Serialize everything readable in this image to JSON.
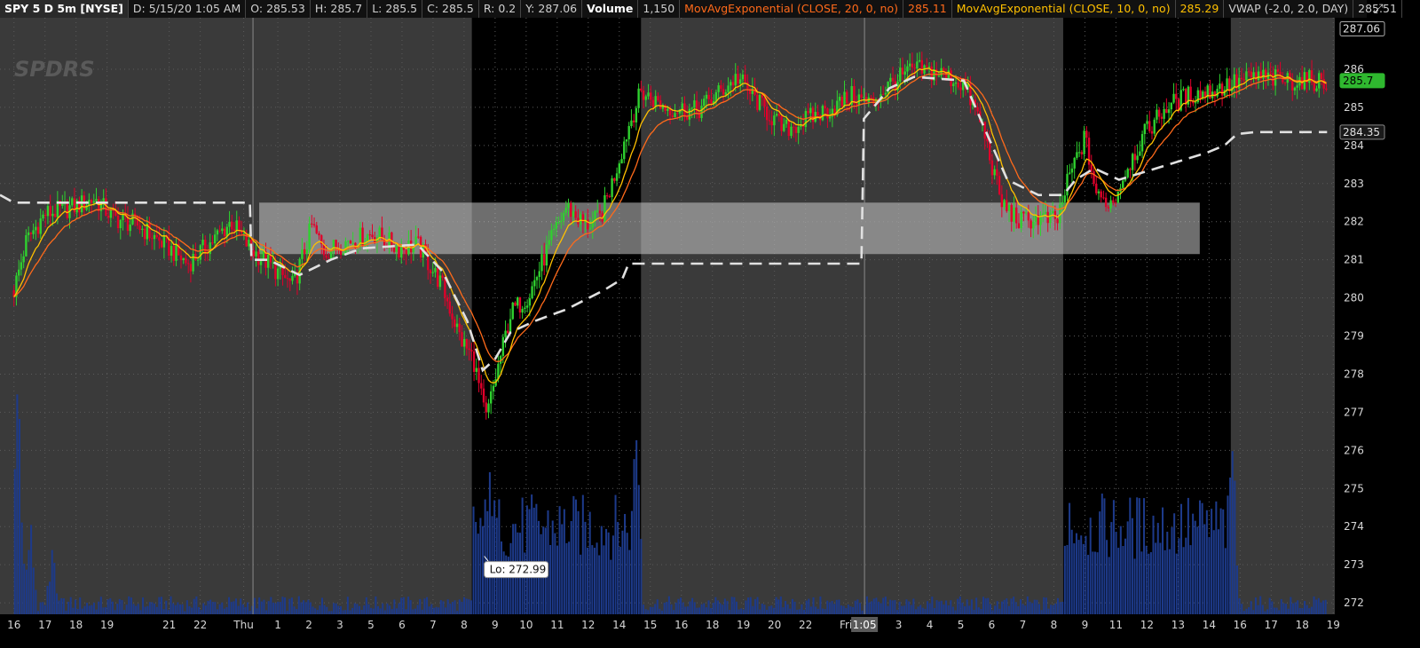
{
  "header": {
    "symbol": "SPY 5 D 5m [NYSE]",
    "date": "D: 5/15/20 1:05 AM",
    "open": "O: 285.53",
    "high": "H: 285.7",
    "low": "L: 285.5",
    "close": "C: 285.5",
    "range": "R: 0.2",
    "y": "Y: 287.06",
    "volume_label": "Volume",
    "volume_value": "1,150",
    "ema20_label": "MovAvgExponential (CLOSE, 20, 0, no)",
    "ema20_value": "285.11",
    "ema10_label": "MovAvgExponential (CLOSE, 10, 0, no)",
    "ema10_value": "285.29",
    "vwap_label": "VWAP (-2.0, 2.0, DAY)",
    "vwap_value": "285.51",
    "corner_icon": "expand-icon"
  },
  "watermark": "SPDRS",
  "colors": {
    "background": "#000000",
    "extended_hours_bg": "#3a3a3a",
    "up_candle": "#2fd12f",
    "down_candle": "#e0002a",
    "ema20": "#ff6a1a",
    "ema10": "#ffc000",
    "vwap": "#e0e0e0",
    "volume": "#1d3a8a",
    "price_tag_current": "#2fb82f",
    "zone": "#c8c8c8"
  },
  "chart_data": {
    "type": "candlestick",
    "symbol": "SPY",
    "interval": "5m",
    "ylim": [
      271.7,
      287.35
    ],
    "y_ticks": [
      272,
      273,
      274,
      275,
      276,
      277,
      278,
      279,
      280,
      281,
      282,
      283,
      284,
      285,
      286
    ],
    "x_ticks": [
      {
        "label": "16",
        "x": 0
      },
      {
        "label": "17",
        "x": 1
      },
      {
        "label": "18",
        "x": 2
      },
      {
        "label": "19",
        "x": 3
      },
      {
        "label": "21",
        "x": 5
      },
      {
        "label": "22",
        "x": 6
      },
      {
        "label": "Thu",
        "x": 7.4
      },
      {
        "label": "1",
        "x": 8.5
      },
      {
        "label": "2",
        "x": 9.5
      },
      {
        "label": "3",
        "x": 10.5
      },
      {
        "label": "5",
        "x": 11.5
      },
      {
        "label": "6",
        "x": 12.5
      },
      {
        "label": "7",
        "x": 13.5
      },
      {
        "label": "8",
        "x": 14.5
      },
      {
        "label": "9",
        "x": 15.5
      },
      {
        "label": "10",
        "x": 16.5
      },
      {
        "label": "11",
        "x": 17.5
      },
      {
        "label": "12",
        "x": 18.5
      },
      {
        "label": "14",
        "x": 19.5
      },
      {
        "label": "15",
        "x": 20.5
      },
      {
        "label": "16",
        "x": 21.5
      },
      {
        "label": "18",
        "x": 22.5
      },
      {
        "label": "19",
        "x": 23.5
      },
      {
        "label": "20",
        "x": 24.5
      },
      {
        "label": "22",
        "x": 25.5
      },
      {
        "label": "Fri",
        "x": 26.8
      },
      {
        "label": "3",
        "x": 28.5
      },
      {
        "label": "4",
        "x": 29.5
      },
      {
        "label": "5",
        "x": 30.5
      },
      {
        "label": "6",
        "x": 31.5
      },
      {
        "label": "7",
        "x": 32.5
      },
      {
        "label": "8",
        "x": 33.5
      },
      {
        "label": "9",
        "x": 34.5
      },
      {
        "label": "11",
        "x": 35.5
      },
      {
        "label": "12",
        "x": 36.5
      },
      {
        "label": "13",
        "x": 37.5
      },
      {
        "label": "14",
        "x": 38.5
      },
      {
        "label": "16",
        "x": 39.5
      },
      {
        "label": "17",
        "x": 40.5
      },
      {
        "label": "18",
        "x": 41.5
      },
      {
        "label": "19",
        "x": 42.5
      }
    ],
    "x_range": [
      -0.45,
      42.55
    ],
    "cursor_label": "1:05",
    "cursor_x": 27.4,
    "regular_sessions": [
      [
        14.75,
        20.2
      ],
      [
        33.8,
        39.2
      ]
    ],
    "day_separators": [
      7.7,
      27.4
    ],
    "close_path": [
      {
        "x": 0.0,
        "y": 280.2
      },
      {
        "x": 0.4,
        "y": 281.5
      },
      {
        "x": 1.0,
        "y": 282.2
      },
      {
        "x": 2.0,
        "y": 282.4
      },
      {
        "x": 2.6,
        "y": 282.6
      },
      {
        "x": 3.2,
        "y": 282.1
      },
      {
        "x": 4.0,
        "y": 281.9
      },
      {
        "x": 5.0,
        "y": 281.3
      },
      {
        "x": 5.6,
        "y": 280.9
      },
      {
        "x": 6.4,
        "y": 281.5
      },
      {
        "x": 7.0,
        "y": 282.0
      },
      {
        "x": 7.6,
        "y": 281.3
      },
      {
        "x": 8.2,
        "y": 280.9
      },
      {
        "x": 9.0,
        "y": 280.3
      },
      {
        "x": 9.6,
        "y": 281.9
      },
      {
        "x": 10.0,
        "y": 281.2
      },
      {
        "x": 10.8,
        "y": 281.5
      },
      {
        "x": 11.6,
        "y": 281.7
      },
      {
        "x": 12.4,
        "y": 281.3
      },
      {
        "x": 13.0,
        "y": 281.4
      },
      {
        "x": 13.8,
        "y": 280.3
      },
      {
        "x": 14.4,
        "y": 278.9
      },
      {
        "x": 14.8,
        "y": 278.4
      },
      {
        "x": 15.2,
        "y": 276.8
      },
      {
        "x": 15.6,
        "y": 278.2
      },
      {
        "x": 16.0,
        "y": 279.6
      },
      {
        "x": 16.6,
        "y": 280.1
      },
      {
        "x": 17.2,
        "y": 281.3
      },
      {
        "x": 17.8,
        "y": 282.4
      },
      {
        "x": 18.4,
        "y": 281.9
      },
      {
        "x": 18.9,
        "y": 282.1
      },
      {
        "x": 19.3,
        "y": 283.1
      },
      {
        "x": 19.8,
        "y": 284.5
      },
      {
        "x": 20.2,
        "y": 285.4
      },
      {
        "x": 21.0,
        "y": 285.0
      },
      {
        "x": 22.0,
        "y": 284.9
      },
      {
        "x": 22.6,
        "y": 285.3
      },
      {
        "x": 23.3,
        "y": 285.8
      },
      {
        "x": 24.0,
        "y": 285.1
      },
      {
        "x": 24.8,
        "y": 284.4
      },
      {
        "x": 25.6,
        "y": 284.7
      },
      {
        "x": 26.4,
        "y": 285.0
      },
      {
        "x": 27.0,
        "y": 285.3
      },
      {
        "x": 27.6,
        "y": 285.1
      },
      {
        "x": 28.2,
        "y": 285.6
      },
      {
        "x": 29.0,
        "y": 286.0
      },
      {
        "x": 29.8,
        "y": 285.9
      },
      {
        "x": 30.6,
        "y": 285.6
      },
      {
        "x": 31.2,
        "y": 284.5
      },
      {
        "x": 31.8,
        "y": 282.5
      },
      {
        "x": 32.4,
        "y": 282.0
      },
      {
        "x": 33.0,
        "y": 282.1
      },
      {
        "x": 33.6,
        "y": 282.0
      },
      {
        "x": 34.0,
        "y": 283.2
      },
      {
        "x": 34.5,
        "y": 284.2
      },
      {
        "x": 34.9,
        "y": 282.6
      },
      {
        "x": 35.4,
        "y": 282.5
      },
      {
        "x": 35.9,
        "y": 283.5
      },
      {
        "x": 36.5,
        "y": 284.4
      },
      {
        "x": 37.1,
        "y": 285.0
      },
      {
        "x": 37.8,
        "y": 285.3
      },
      {
        "x": 38.4,
        "y": 285.4
      },
      {
        "x": 39.2,
        "y": 285.6
      },
      {
        "x": 40.0,
        "y": 285.8
      },
      {
        "x": 41.0,
        "y": 285.7
      },
      {
        "x": 42.0,
        "y": 285.7
      },
      {
        "x": 42.3,
        "y": 285.6
      }
    ],
    "vwap_path": [
      {
        "x": -0.45,
        "y": 282.7
      },
      {
        "x": 0.0,
        "y": 282.5
      },
      {
        "x": 7.6,
        "y": 282.5
      },
      {
        "x": 7.65,
        "y": 281.0
      },
      {
        "x": 8.2,
        "y": 281.0
      },
      {
        "x": 9.2,
        "y": 280.6
      },
      {
        "x": 10.2,
        "y": 281.0
      },
      {
        "x": 11.2,
        "y": 281.3
      },
      {
        "x": 13.0,
        "y": 281.4
      },
      {
        "x": 13.8,
        "y": 280.7
      },
      {
        "x": 14.6,
        "y": 279.4
      },
      {
        "x": 15.1,
        "y": 278.1
      },
      {
        "x": 15.5,
        "y": 278.4
      },
      {
        "x": 16.0,
        "y": 279.1
      },
      {
        "x": 16.8,
        "y": 279.4
      },
      {
        "x": 17.8,
        "y": 279.7
      },
      {
        "x": 19.0,
        "y": 280.2
      },
      {
        "x": 19.6,
        "y": 280.5
      },
      {
        "x": 19.8,
        "y": 280.9
      },
      {
        "x": 27.3,
        "y": 280.9
      },
      {
        "x": 27.38,
        "y": 284.7
      },
      {
        "x": 28.2,
        "y": 285.5
      },
      {
        "x": 29.0,
        "y": 285.8
      },
      {
        "x": 30.6,
        "y": 285.7
      },
      {
        "x": 31.4,
        "y": 284.2
      },
      {
        "x": 32.0,
        "y": 283.1
      },
      {
        "x": 33.0,
        "y": 282.7
      },
      {
        "x": 33.8,
        "y": 282.7
      },
      {
        "x": 34.2,
        "y": 283.1
      },
      {
        "x": 34.8,
        "y": 283.4
      },
      {
        "x": 35.6,
        "y": 283.1
      },
      {
        "x": 36.4,
        "y": 283.3
      },
      {
        "x": 37.2,
        "y": 283.5
      },
      {
        "x": 38.4,
        "y": 283.8
      },
      {
        "x": 39.0,
        "y": 284.0
      },
      {
        "x": 39.4,
        "y": 284.3
      },
      {
        "x": 40.0,
        "y": 284.35
      },
      {
        "x": 42.3,
        "y": 284.35
      }
    ],
    "volume_peaks": [
      {
        "x": 0.1,
        "v": 1.0
      },
      {
        "x": 0.5,
        "v": 0.35
      },
      {
        "x": 1.2,
        "v": 0.25
      },
      {
        "x": 15.3,
        "v": 0.75
      },
      {
        "x": 15.6,
        "v": 0.45
      },
      {
        "x": 20.0,
        "v": 0.9
      },
      {
        "x": 34.0,
        "v": 0.55
      },
      {
        "x": 39.2,
        "v": 0.85
      },
      {
        "x": 38.9,
        "v": 0.35
      }
    ],
    "shaded_zone": {
      "x1": 7.9,
      "x2": 38.2,
      "y1": 281.15,
      "y2": 282.5
    },
    "low_marker": {
      "x": 15.15,
      "y": 272.99,
      "label": "Lo: 272.99"
    },
    "price_tags": [
      {
        "value": 287.06,
        "label": "287.06",
        "style": "plain"
      },
      {
        "value": 285.7,
        "label": "285.7",
        "style": "current"
      },
      {
        "value": 284.35,
        "label": "284.35",
        "style": "vwap"
      }
    ],
    "series": [
      {
        "name": "MovAvgExponential (CLOSE, 20, 0, no)",
        "last": 285.11
      },
      {
        "name": "MovAvgExponential (CLOSE, 10, 0, no)",
        "last": 285.29
      },
      {
        "name": "VWAP (-2.0, 2.0, DAY)",
        "last": 285.51
      }
    ]
  }
}
